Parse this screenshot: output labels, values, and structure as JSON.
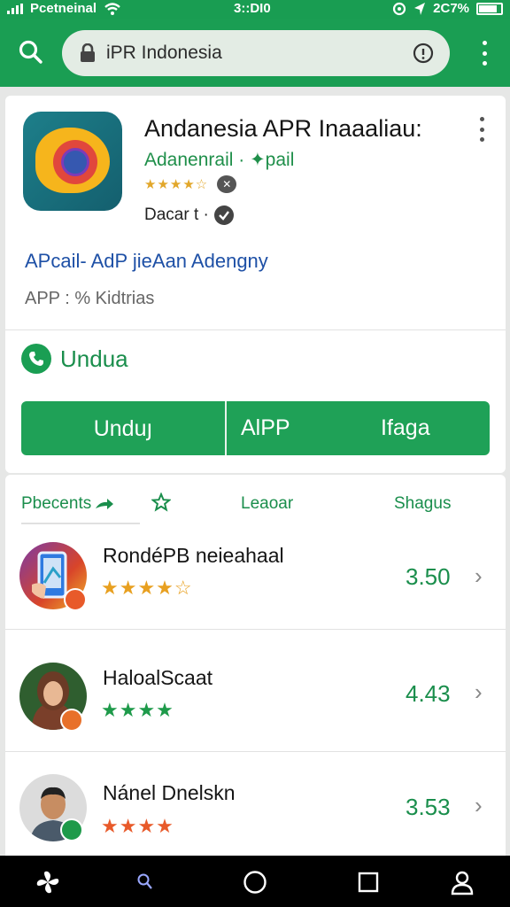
{
  "status_bar": {
    "carrier": "Pcetneinal",
    "time": "3::DI0",
    "battery": "2C7%"
  },
  "browser": {
    "url": "iPR Indonesia"
  },
  "app": {
    "title": "Andanesia APR Inaaaliau:",
    "developer": "Adanenrail · ✦pail",
    "rating_stars": "★★★★☆",
    "sub_label": "Dacar t ·",
    "tagline": "APcail- AdP jieAan Adengny",
    "meta": "APP : % Kidtrias",
    "install_label": "Undua",
    "buttons": {
      "primary": "Unduյ",
      "secondary": "AlPP",
      "tertiary": "Ifaga"
    }
  },
  "tabs": {
    "tab1": "Pbecents",
    "tab3": "Leaoar",
    "tab4": "Shagus"
  },
  "items": [
    {
      "name": "RondéPB neieahaal",
      "stars": "★★★★☆",
      "score": "3.50",
      "star_color": "#e8a020"
    },
    {
      "name": "HaloalScaat",
      "stars": "★★★★",
      "score": "4.43",
      "star_color": "#1e9a4a"
    },
    {
      "name": "Nánel Dnelskn",
      "stars": "★★★★",
      "score": "3.53",
      "star_color": "#e85a2a"
    }
  ],
  "colors": {
    "accent": "#1a9e53",
    "link": "#1e50a6"
  },
  "icons": [
    "search-icon",
    "lock-icon",
    "info-icon",
    "more-vert-icon",
    "phone-icon",
    "chevron-right-icon",
    "pinwheel-icon",
    "search-nav-icon",
    "home-circle-icon",
    "square-recents-icon",
    "person-icon"
  ]
}
